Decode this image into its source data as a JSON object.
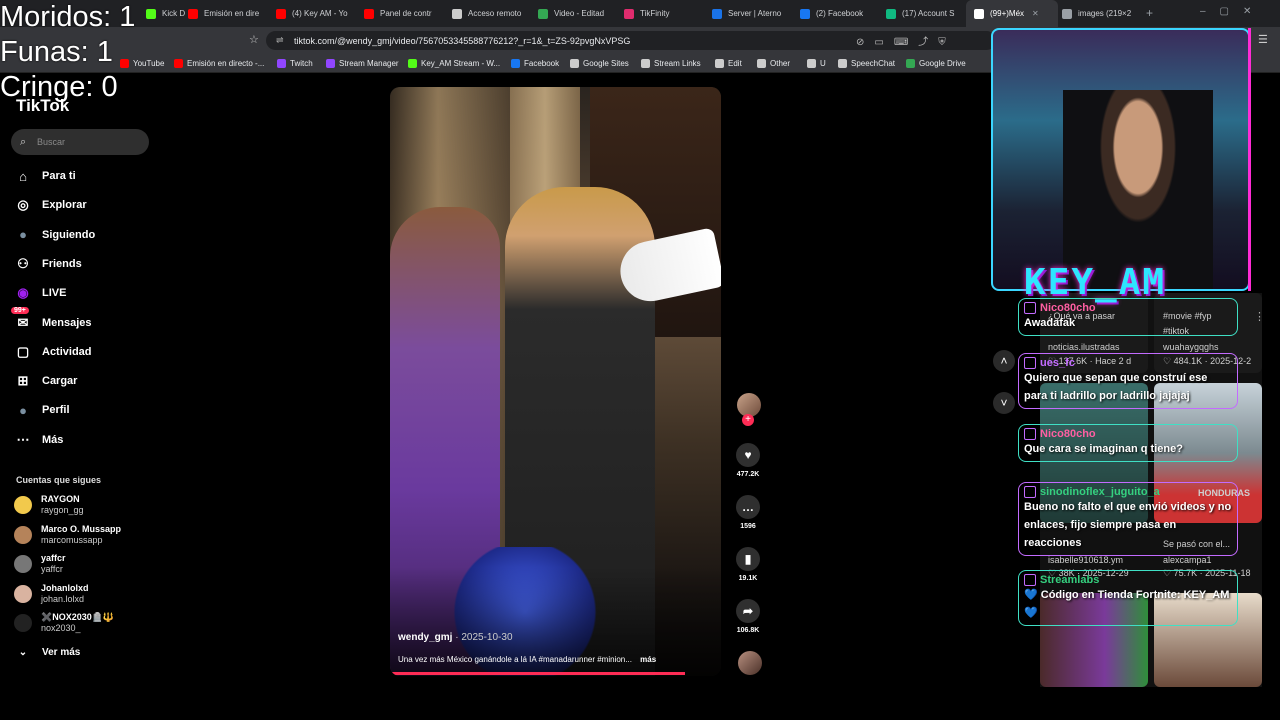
{
  "counters": {
    "moridos": "Moridos: 1",
    "funas": "Funas: 1",
    "cringe": "Cringe: 0"
  },
  "browser": {
    "tabs": [
      {
        "label": "Kick D",
        "color": "#53fc18"
      },
      {
        "label": "Emisión en dire",
        "color": "#ff0000"
      },
      {
        "label": "(4) Key AM - Yo",
        "color": "#ff0000"
      },
      {
        "label": "Panel de contr",
        "color": "#ff0000"
      },
      {
        "label": "Acceso remoto",
        "color": "#cccccc"
      },
      {
        "label": "Video - Editad",
        "color": "#34a853"
      },
      {
        "label": "TikFinity",
        "color": "#e02c6e"
      },
      {
        "label": "Server | Aterno",
        "color": "#1a73e8"
      },
      {
        "label": "(2) Facebook",
        "color": "#1877f2"
      },
      {
        "label": "(17) Account S",
        "color": "#10b981"
      },
      {
        "label": "(99+)Méx",
        "color": "#ffffff"
      },
      {
        "label": "images (219×2",
        "color": "#9aa0a6"
      }
    ],
    "url": "tiktok.com/@wendy_gmj/video/7567053345588776212?_r=1&_t=ZS-92pvgNxVPSG",
    "bookmarks": [
      {
        "label": "YouTube",
        "color": "#ff0000"
      },
      {
        "label": "Emisión en directo -...",
        "color": "#ff0000"
      },
      {
        "label": "Twitch",
        "color": "#9146ff"
      },
      {
        "label": "Stream Manager",
        "color": "#9146ff"
      },
      {
        "label": "Key_AM Stream - W...",
        "color": "#53fc18"
      },
      {
        "label": "Facebook",
        "color": "#1877f2"
      },
      {
        "label": "Google Sites",
        "color": "#cccccc"
      },
      {
        "label": "Stream Links",
        "color": "#cccccc"
      },
      {
        "label": "Edit",
        "color": "#cccccc"
      },
      {
        "label": "Other",
        "color": "#cccccc"
      },
      {
        "label": "U",
        "color": "#cccccc"
      },
      {
        "label": "SpeechChat",
        "color": "#cccccc"
      },
      {
        "label": "Google Drive",
        "color": "#34a853"
      }
    ]
  },
  "tiktok": {
    "logo": "TikTok",
    "search_placeholder": "Buscar",
    "nav": [
      {
        "label": "Para ti",
        "icon": "home-icon"
      },
      {
        "label": "Explorar",
        "icon": "compass-icon"
      },
      {
        "label": "Siguiendo",
        "icon": "following-icon"
      },
      {
        "label": "Friends",
        "icon": "friends-icon"
      },
      {
        "label": "LIVE",
        "icon": "live-icon"
      },
      {
        "label": "Mensajes",
        "icon": "messages-icon",
        "badge": "99+"
      },
      {
        "label": "Actividad",
        "icon": "activity-icon"
      },
      {
        "label": "Cargar",
        "icon": "upload-icon"
      },
      {
        "label": "Perfil",
        "icon": "profile-icon"
      },
      {
        "label": "Más",
        "icon": "more-icon"
      }
    ],
    "following_title": "Cuentas que sigues",
    "following": [
      {
        "name": "RAYGON",
        "handle": "raygon_gg",
        "color": "#f2c94c"
      },
      {
        "name": "Marco O. Mussapp",
        "handle": "marcomussapp",
        "color": "#b5835a"
      },
      {
        "name": "yaffcr",
        "handle": "yaffcr",
        "color": "#777777"
      },
      {
        "name": "Johanlolxd",
        "handle": "johan.lolxd",
        "color": "#d9b3a0"
      },
      {
        "name": "✖️NOX2030🪦🔱",
        "handle": "nox2030_",
        "color": "#222222"
      }
    ],
    "see_more": "Ver más",
    "video": {
      "user": "wendy_gmj",
      "date": "· 2025-10-30",
      "caption": "Una vez más México ganándole a lá IA #manadarunner #minion...",
      "more": "más",
      "progress": 0.89
    },
    "actions": {
      "likes": "477.2K",
      "comments": "1596",
      "saves": "19.1K",
      "shares": "106.8K"
    }
  },
  "stream": {
    "name": "KEY_AM",
    "chat": [
      {
        "user": "Nico80cho",
        "color": "#ff5fa2",
        "message": "Awadafak"
      },
      {
        "user": "ues_fc",
        "color": "#c36bff",
        "message": "Quiero que sepan que construí ese para ti ladrillo por ladrillo jajajaj"
      },
      {
        "user": "Nico80cho",
        "color": "#ff5fa2",
        "message": "Que cara se imaginan q tiene?"
      },
      {
        "user": "sinodinoflex_juguito_a",
        "color": "#35d07f",
        "message": "Bueno no falto el que envió videos y no enlaces, fijo siempre pasa en reacciones"
      },
      {
        "user": "Streamlabs",
        "color": "#35d07f",
        "message": "💙 Código en Tienda Fortnite: KEY_AM 💙"
      }
    ],
    "ghost": {
      "g1": "¿Qué va a pasar",
      "g2": "#movie #fyp",
      "g3": "#tiktok",
      "g4": "noticias.ilustradas",
      "g5": "♡ 137.6K · Hace 2 d",
      "g6": "♡ 484.1K · 2025-12-2",
      "g7": "wuahaygqghs",
      "g8": "isabelle910618.ym",
      "g9": "alexcampa1",
      "g10": "♡ 38K · 2025-12-29",
      "g11": "♡ 75.7K · 2025-11-18",
      "g12": "Se pasó con el...",
      "g13": "HONDURAS"
    }
  }
}
